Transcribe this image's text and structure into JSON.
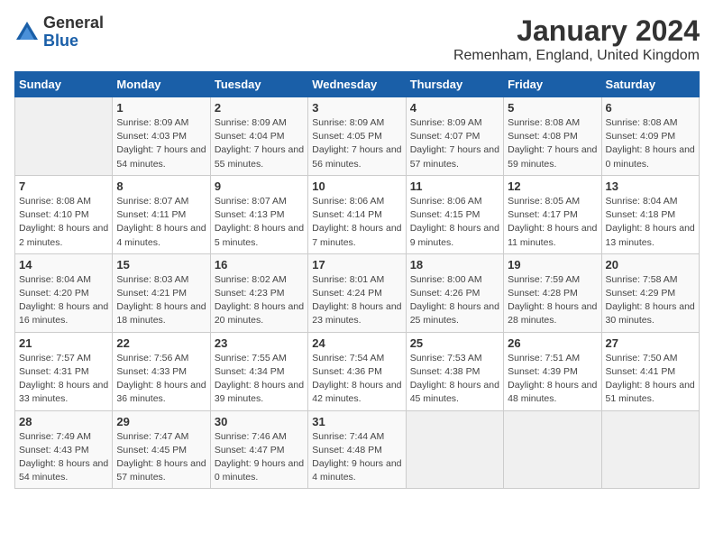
{
  "header": {
    "logo": {
      "general": "General",
      "blue": "Blue"
    },
    "title": "January 2024",
    "subtitle": "Remenham, England, United Kingdom"
  },
  "weekdays": [
    "Sunday",
    "Monday",
    "Tuesday",
    "Wednesday",
    "Thursday",
    "Friday",
    "Saturday"
  ],
  "weeks": [
    [
      {
        "day": "",
        "sunrise": "",
        "sunset": "",
        "daylight": ""
      },
      {
        "day": "1",
        "sunrise": "Sunrise: 8:09 AM",
        "sunset": "Sunset: 4:03 PM",
        "daylight": "Daylight: 7 hours and 54 minutes."
      },
      {
        "day": "2",
        "sunrise": "Sunrise: 8:09 AM",
        "sunset": "Sunset: 4:04 PM",
        "daylight": "Daylight: 7 hours and 55 minutes."
      },
      {
        "day": "3",
        "sunrise": "Sunrise: 8:09 AM",
        "sunset": "Sunset: 4:05 PM",
        "daylight": "Daylight: 7 hours and 56 minutes."
      },
      {
        "day": "4",
        "sunrise": "Sunrise: 8:09 AM",
        "sunset": "Sunset: 4:07 PM",
        "daylight": "Daylight: 7 hours and 57 minutes."
      },
      {
        "day": "5",
        "sunrise": "Sunrise: 8:08 AM",
        "sunset": "Sunset: 4:08 PM",
        "daylight": "Daylight: 7 hours and 59 minutes."
      },
      {
        "day": "6",
        "sunrise": "Sunrise: 8:08 AM",
        "sunset": "Sunset: 4:09 PM",
        "daylight": "Daylight: 8 hours and 0 minutes."
      }
    ],
    [
      {
        "day": "7",
        "sunrise": "Sunrise: 8:08 AM",
        "sunset": "Sunset: 4:10 PM",
        "daylight": "Daylight: 8 hours and 2 minutes."
      },
      {
        "day": "8",
        "sunrise": "Sunrise: 8:07 AM",
        "sunset": "Sunset: 4:11 PM",
        "daylight": "Daylight: 8 hours and 4 minutes."
      },
      {
        "day": "9",
        "sunrise": "Sunrise: 8:07 AM",
        "sunset": "Sunset: 4:13 PM",
        "daylight": "Daylight: 8 hours and 5 minutes."
      },
      {
        "day": "10",
        "sunrise": "Sunrise: 8:06 AM",
        "sunset": "Sunset: 4:14 PM",
        "daylight": "Daylight: 8 hours and 7 minutes."
      },
      {
        "day": "11",
        "sunrise": "Sunrise: 8:06 AM",
        "sunset": "Sunset: 4:15 PM",
        "daylight": "Daylight: 8 hours and 9 minutes."
      },
      {
        "day": "12",
        "sunrise": "Sunrise: 8:05 AM",
        "sunset": "Sunset: 4:17 PM",
        "daylight": "Daylight: 8 hours and 11 minutes."
      },
      {
        "day": "13",
        "sunrise": "Sunrise: 8:04 AM",
        "sunset": "Sunset: 4:18 PM",
        "daylight": "Daylight: 8 hours and 13 minutes."
      }
    ],
    [
      {
        "day": "14",
        "sunrise": "Sunrise: 8:04 AM",
        "sunset": "Sunset: 4:20 PM",
        "daylight": "Daylight: 8 hours and 16 minutes."
      },
      {
        "day": "15",
        "sunrise": "Sunrise: 8:03 AM",
        "sunset": "Sunset: 4:21 PM",
        "daylight": "Daylight: 8 hours and 18 minutes."
      },
      {
        "day": "16",
        "sunrise": "Sunrise: 8:02 AM",
        "sunset": "Sunset: 4:23 PM",
        "daylight": "Daylight: 8 hours and 20 minutes."
      },
      {
        "day": "17",
        "sunrise": "Sunrise: 8:01 AM",
        "sunset": "Sunset: 4:24 PM",
        "daylight": "Daylight: 8 hours and 23 minutes."
      },
      {
        "day": "18",
        "sunrise": "Sunrise: 8:00 AM",
        "sunset": "Sunset: 4:26 PM",
        "daylight": "Daylight: 8 hours and 25 minutes."
      },
      {
        "day": "19",
        "sunrise": "Sunrise: 7:59 AM",
        "sunset": "Sunset: 4:28 PM",
        "daylight": "Daylight: 8 hours and 28 minutes."
      },
      {
        "day": "20",
        "sunrise": "Sunrise: 7:58 AM",
        "sunset": "Sunset: 4:29 PM",
        "daylight": "Daylight: 8 hours and 30 minutes."
      }
    ],
    [
      {
        "day": "21",
        "sunrise": "Sunrise: 7:57 AM",
        "sunset": "Sunset: 4:31 PM",
        "daylight": "Daylight: 8 hours and 33 minutes."
      },
      {
        "day": "22",
        "sunrise": "Sunrise: 7:56 AM",
        "sunset": "Sunset: 4:33 PM",
        "daylight": "Daylight: 8 hours and 36 minutes."
      },
      {
        "day": "23",
        "sunrise": "Sunrise: 7:55 AM",
        "sunset": "Sunset: 4:34 PM",
        "daylight": "Daylight: 8 hours and 39 minutes."
      },
      {
        "day": "24",
        "sunrise": "Sunrise: 7:54 AM",
        "sunset": "Sunset: 4:36 PM",
        "daylight": "Daylight: 8 hours and 42 minutes."
      },
      {
        "day": "25",
        "sunrise": "Sunrise: 7:53 AM",
        "sunset": "Sunset: 4:38 PM",
        "daylight": "Daylight: 8 hours and 45 minutes."
      },
      {
        "day": "26",
        "sunrise": "Sunrise: 7:51 AM",
        "sunset": "Sunset: 4:39 PM",
        "daylight": "Daylight: 8 hours and 48 minutes."
      },
      {
        "day": "27",
        "sunrise": "Sunrise: 7:50 AM",
        "sunset": "Sunset: 4:41 PM",
        "daylight": "Daylight: 8 hours and 51 minutes."
      }
    ],
    [
      {
        "day": "28",
        "sunrise": "Sunrise: 7:49 AM",
        "sunset": "Sunset: 4:43 PM",
        "daylight": "Daylight: 8 hours and 54 minutes."
      },
      {
        "day": "29",
        "sunrise": "Sunrise: 7:47 AM",
        "sunset": "Sunset: 4:45 PM",
        "daylight": "Daylight: 8 hours and 57 minutes."
      },
      {
        "day": "30",
        "sunrise": "Sunrise: 7:46 AM",
        "sunset": "Sunset: 4:47 PM",
        "daylight": "Daylight: 9 hours and 0 minutes."
      },
      {
        "day": "31",
        "sunrise": "Sunrise: 7:44 AM",
        "sunset": "Sunset: 4:48 PM",
        "daylight": "Daylight: 9 hours and 4 minutes."
      },
      {
        "day": "",
        "sunrise": "",
        "sunset": "",
        "daylight": ""
      },
      {
        "day": "",
        "sunrise": "",
        "sunset": "",
        "daylight": ""
      },
      {
        "day": "",
        "sunrise": "",
        "sunset": "",
        "daylight": ""
      }
    ]
  ]
}
